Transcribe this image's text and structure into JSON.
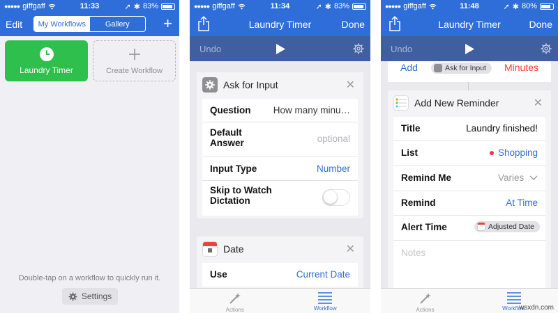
{
  "screen1": {
    "status": {
      "carrier": "giffgaff",
      "time": "11:33",
      "battery": "83%"
    },
    "nav": {
      "edit": "Edit",
      "tab_my": "My Workflows",
      "tab_gallery": "Gallery",
      "add": "+"
    },
    "tiles": {
      "laundry": "Laundry Timer",
      "create": "Create Workflow"
    },
    "hint": "Double-tap on a workflow to quickly run it.",
    "settings": "Settings",
    "colors": {
      "accent": "#2f6ed9",
      "tile": "#2fbf4d"
    }
  },
  "screen2": {
    "status": {
      "carrier": "giffgaff",
      "time": "11:34",
      "battery": "83%"
    },
    "nav": {
      "title": "Laundry Timer",
      "done": "Done"
    },
    "toolbar": {
      "undo": "Undo"
    },
    "ask": {
      "title": "Ask for Input",
      "question_k": "Question",
      "question_v": "How many minu…",
      "default_k1": "Default",
      "default_k2": "Answer",
      "default_v": "optional",
      "type_k": "Input Type",
      "type_v": "Number",
      "skip_k1": "Skip to Watch",
      "skip_k2": "Dictation"
    },
    "date": {
      "title": "Date",
      "use_k": "Use",
      "use_v": "Current Date"
    },
    "tabs": {
      "actions": "Actions",
      "workflow": "Workflow"
    }
  },
  "screen3": {
    "status": {
      "carrier": "giffgaff",
      "time": "11:48",
      "battery": "80%"
    },
    "nav": {
      "title": "Laundry Timer",
      "done": "Done"
    },
    "toolbar": {
      "undo": "Undo"
    },
    "prev": {
      "add": "Add",
      "chip": "Ask for Input",
      "minutes": "Minutes"
    },
    "reminder": {
      "title": "Add New Reminder",
      "title_k": "Title",
      "title_v": "Laundry finished!",
      "list_k": "List",
      "list_v": "Shopping",
      "remind_me_k": "Remind Me",
      "remind_me_v": "Varies",
      "remind_k": "Remind",
      "remind_v": "At Time",
      "alert_k": "Alert Time",
      "alert_v": "Adjusted Date",
      "notes": "Notes"
    },
    "tabs": {
      "actions": "Actions",
      "workflow": "Workflow"
    },
    "watermark": "wsxdn.com"
  }
}
